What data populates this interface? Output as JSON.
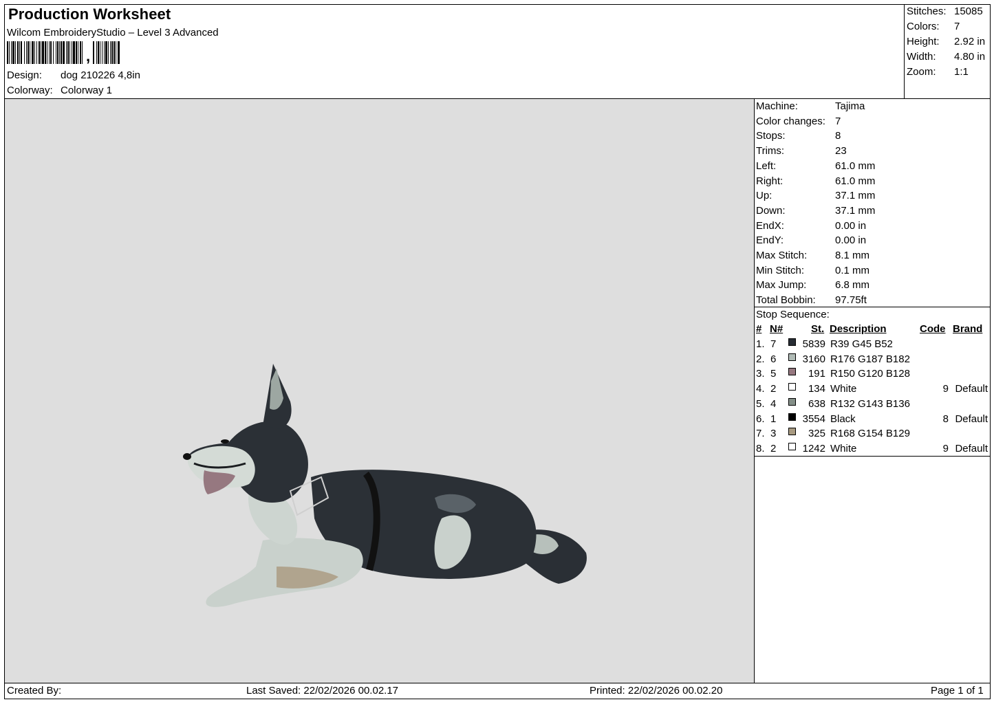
{
  "header": {
    "title": "Production Worksheet",
    "software": "Wilcom EmbroideryStudio – Level 3 Advanced",
    "design_label": "Design:",
    "design_value": "dog 210226 4,8in",
    "colorway_label": "Colorway:",
    "colorway_value": "Colorway 1"
  },
  "summary": [
    {
      "label": "Stitches:",
      "value": "15085"
    },
    {
      "label": "Colors:",
      "value": "7"
    },
    {
      "label": "Height:",
      "value": "2.92 in"
    },
    {
      "label": "Width:",
      "value": "4.80 in"
    },
    {
      "label": "Zoom:",
      "value": "1:1"
    }
  ],
  "machine_info": [
    {
      "label": "Machine:",
      "value": "Tajima"
    },
    {
      "label": "Color changes:",
      "value": "7"
    },
    {
      "label": "Stops:",
      "value": "8"
    },
    {
      "label": "Trims:",
      "value": "23"
    },
    {
      "label": "Left:",
      "value": "61.0 mm"
    },
    {
      "label": "Right:",
      "value": "61.0 mm"
    },
    {
      "label": "Up:",
      "value": "37.1 mm"
    },
    {
      "label": "Down:",
      "value": "37.1 mm"
    },
    {
      "label": "EndX:",
      "value": "0.00 in"
    },
    {
      "label": "EndY:",
      "value": "0.00 in"
    },
    {
      "label": "Max Stitch:",
      "value": "8.1 mm"
    },
    {
      "label": "Min Stitch:",
      "value": "0.1 mm"
    },
    {
      "label": "Max Jump:",
      "value": "6.8 mm"
    },
    {
      "label": "Total Bobbin:",
      "value": "97.75ft"
    }
  ],
  "stop_sequence": {
    "title": "Stop Sequence:",
    "headers": {
      "num": "#",
      "needle": "N#",
      "stitches": "St.",
      "description": "Description",
      "code": "Code",
      "brand": "Brand"
    },
    "rows": [
      {
        "num": "1.",
        "needle": "7",
        "color": "#272d34",
        "stitches": "5839",
        "description": "R39 G45 B52",
        "code": "",
        "brand": ""
      },
      {
        "num": "2.",
        "needle": "6",
        "color": "#b0bbb6",
        "stitches": "3160",
        "description": "R176 G187 B182",
        "code": "",
        "brand": ""
      },
      {
        "num": "3.",
        "needle": "5",
        "color": "#967880",
        "stitches": "191",
        "description": "R150 G120 B128",
        "code": "",
        "brand": ""
      },
      {
        "num": "4.",
        "needle": "2",
        "color": "#ffffff",
        "stitches": "134",
        "description": "White",
        "code": "9",
        "brand": "Default"
      },
      {
        "num": "5.",
        "needle": "4",
        "color": "#848f88",
        "stitches": "638",
        "description": "R132 G143 B136",
        "code": "",
        "brand": ""
      },
      {
        "num": "6.",
        "needle": "1",
        "color": "#000000",
        "stitches": "3554",
        "description": "Black",
        "code": "8",
        "brand": "Default"
      },
      {
        "num": "7.",
        "needle": "3",
        "color": "#a89a81",
        "stitches": "325",
        "description": "R168 G154 B129",
        "code": "",
        "brand": ""
      },
      {
        "num": "8.",
        "needle": "2",
        "color": "#ffffff",
        "stitches": "1242",
        "description": "White",
        "code": "9",
        "brand": "Default"
      }
    ]
  },
  "footer": {
    "created_by": "Created By:",
    "last_saved": "Last Saved: 22/02/2026 00.02.17",
    "printed": "Printed: 22/02/2026 00.02.20",
    "page": "Page 1 of 1"
  },
  "barcode_text": ","
}
